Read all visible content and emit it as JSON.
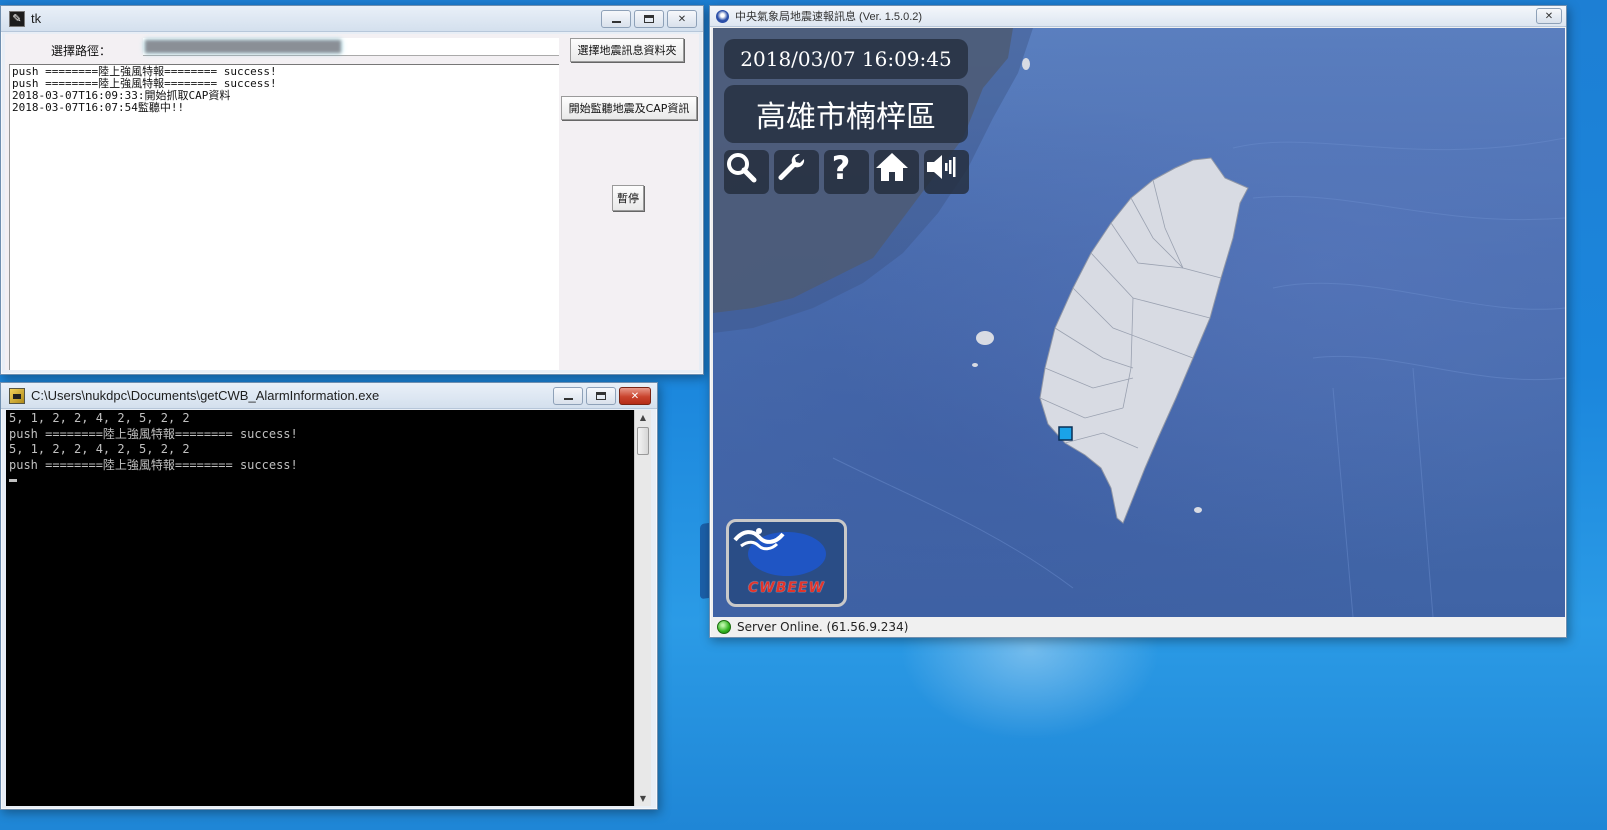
{
  "tk_window": {
    "title": "tk",
    "path_label": "選擇路徑：",
    "path_value": "",
    "buttons": {
      "choose_folder": "選擇地震訊息資料夾",
      "start_monitor": "開始監聽地震及CAP資訊",
      "pause": "暫停"
    },
    "log_lines": [
      "push ========陸上強風特報======== success!",
      "push ========陸上強風特報======== success!",
      "2018-03-07T16:09:33:開始抓取CAP資料",
      "2018-03-07T16:07:54監聽中!!"
    ]
  },
  "console_window": {
    "title": "C:\\Users\\nukdpc\\Documents\\getCWB_AlarmInformation.exe",
    "lines": [
      "5, 1, 2, 2, 4, 2, 5, 2, 2",
      "push ========陸上強風特報======== success!",
      "5, 1, 2, 2, 4, 2, 5, 2, 2",
      "push ========陸上強風特報======== success!"
    ]
  },
  "cwb_window": {
    "title": "中央氣象局地震速報訊息 (Ver. 1.5.0.2)",
    "datetime": "2018/03/07 16:09:45",
    "location": "高雄市楠梓區",
    "toolbar_icons": [
      "search-icon",
      "wrench-icon",
      "help-icon",
      "home-icon",
      "speaker-icon"
    ],
    "logo_text": "CWBEEW",
    "status_text": "Server Online. (61.56.9.234)",
    "colors": {
      "status_online": "#2fb21e",
      "marker": "#1aa3e8",
      "sea": "#4b6fb0",
      "land": "#d8dbe3"
    }
  }
}
